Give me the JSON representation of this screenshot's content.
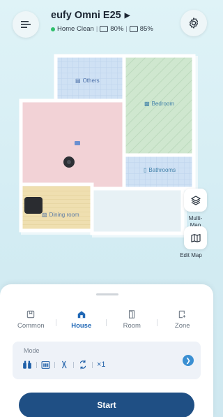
{
  "header": {
    "device_name": "eufy Omni E25",
    "status_text": "Home Clean",
    "battery": "80%",
    "water": "85%"
  },
  "map": {
    "rooms": {
      "others": "Others",
      "bedroom": "Bedroom",
      "bathrooms": "Bathrooms",
      "dining": "Dining room"
    },
    "side_buttons": {
      "multi_map": "Multi-\nMap",
      "edit_map": "Edit Map"
    }
  },
  "tabs": [
    {
      "label": "Common"
    },
    {
      "label": "House"
    },
    {
      "label": "Room"
    },
    {
      "label": "Zone"
    }
  ],
  "mode": {
    "title": "Mode",
    "repeat": "×1"
  },
  "start": {
    "label": "Start"
  },
  "colors": {
    "accent": "#1f67b5",
    "start": "#1f4f84",
    "status_dot": "#2fbf6b"
  }
}
